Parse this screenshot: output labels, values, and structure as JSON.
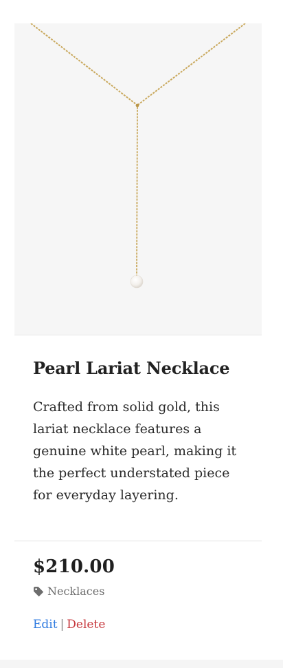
{
  "product": {
    "title": "Pearl Lariat Necklace",
    "description": "Crafted from solid gold, this lariat necklace features a genuine white pearl, making it the perfect understated piece for everyday layering.",
    "price": "$210.00",
    "category": "Necklaces",
    "image_subject": "gold lariat necklace with white pearl"
  },
  "actions": {
    "edit_label": "Edit",
    "separator": "|",
    "delete_label": "Delete"
  },
  "icons": {
    "category_icon": "tag-icon"
  },
  "colors": {
    "edit_link": "#2f7be0",
    "delete_link": "#c6363b",
    "chain_gold": "#c9a85c"
  }
}
